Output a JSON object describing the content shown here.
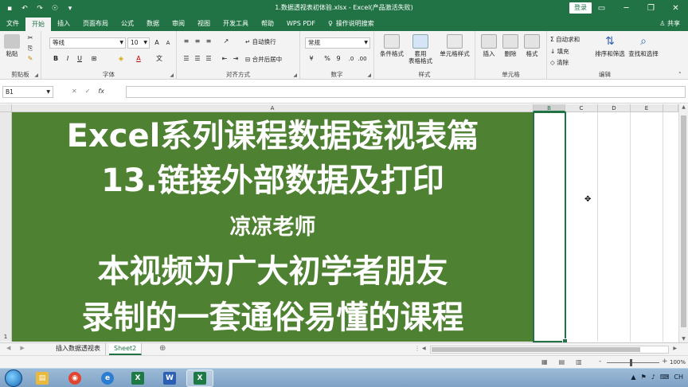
{
  "window": {
    "title": "1.数据透视表初体验.xlsx  -  Excel(产品激活失败)",
    "login_label": "登录",
    "controls": [
      "▭",
      "─",
      "❐",
      "✕"
    ]
  },
  "qat": {
    "save": "▪",
    "undo": "↶",
    "redo": "↷",
    "touch": "☉",
    "more": "▾"
  },
  "tabs": [
    {
      "label": "文件"
    },
    {
      "label": "开始"
    },
    {
      "label": "插入"
    },
    {
      "label": "页面布局"
    },
    {
      "label": "公式"
    },
    {
      "label": "数据"
    },
    {
      "label": "审阅"
    },
    {
      "label": "视图"
    },
    {
      "label": "开发工具"
    },
    {
      "label": "帮助"
    },
    {
      "label": "WPS PDF"
    }
  ],
  "tell_me": "操作说明搜索",
  "share": "共享",
  "ribbon": {
    "clipboard": {
      "label": "剪贴板",
      "paste": "粘贴"
    },
    "font": {
      "label": "字体",
      "name": "等线",
      "size": "10",
      "bold": "B",
      "italic": "I",
      "underline": "U",
      "grow": "A",
      "shrink": "A",
      "color_a": "A",
      "phonetic": "文"
    },
    "align": {
      "label": "对齐方式",
      "wrap": "自动换行",
      "merge": "合并后居中"
    },
    "number": {
      "label": "数字",
      "format": "常规",
      "pct": "%",
      "comma": "9"
    },
    "styles": {
      "label": "样式",
      "cond": "条件格式",
      "table1": "套用",
      "table2": "表格格式",
      "cell": "单元格样式"
    },
    "cells": {
      "label": "单元格",
      "insert": "插入",
      "delete": "删除",
      "format": "格式"
    },
    "editing": {
      "label": "编辑",
      "autosum": "自动求和",
      "fill": "填充",
      "clear": "清除",
      "sort": "排序和筛选",
      "find": "查找和选择"
    }
  },
  "formula_bar": {
    "name_box": "B1",
    "cancel": "✕",
    "enter": "✓",
    "fx": "fx",
    "content": ""
  },
  "columns": [
    {
      "label": "A"
    },
    {
      "label": "B"
    },
    {
      "label": "C"
    },
    {
      "label": "D"
    },
    {
      "label": "E"
    }
  ],
  "row_label": "1",
  "cell_text": [
    "Excel系列课程数据透视表篇",
    "13.链接外部数据及打印",
    "凉凉老师",
    "本视频为广大初学者朋友",
    "录制的一套通俗易懂的课程"
  ],
  "sheets": [
    {
      "label": "插入数据透视表",
      "active": false
    },
    {
      "label": "Sheet2",
      "active": true
    }
  ],
  "add_sheet": "⊕",
  "status": {
    "zoom": "100%",
    "minus": "-",
    "plus": "+"
  },
  "taskbar": {
    "apps": [
      {
        "glyph": "▤",
        "color": "#e8b93c"
      },
      {
        "glyph": "◉",
        "color": "#e0452f"
      },
      {
        "glyph": "e",
        "color": "#2a7dd1"
      },
      {
        "glyph": "X",
        "color": "#1d7a44"
      },
      {
        "glyph": "W",
        "color": "#2b5fb3"
      },
      {
        "glyph": "X",
        "color": "#1d7a44"
      }
    ],
    "tray": [
      "▲",
      "⚑",
      "♪",
      "⌨",
      "CH"
    ]
  },
  "colors": {
    "excel_green": "#217346",
    "cell_fill": "#4f8132"
  }
}
